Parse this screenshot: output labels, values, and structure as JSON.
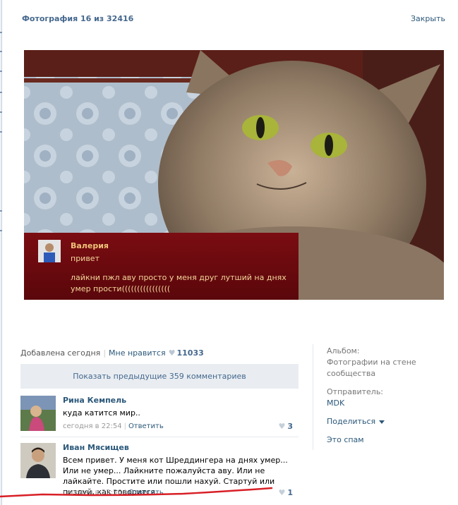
{
  "header": {
    "title": "Фотография 16 из 32416",
    "close_label": "Закрыть"
  },
  "photo_comment": {
    "author": "Валерия",
    "line1": "привет",
    "line2": "лайкни пжл аву просто у меня друг лутший на днях умер прости(((((((((((((((("
  },
  "info": {
    "added": "Добавлена сегодня",
    "like_label": "Мне нравится",
    "like_count": "11033"
  },
  "sidebar": {
    "album_label": "Альбом:",
    "album_value": "Фотографии на стене сообщества",
    "sender_label": "Отправитель:",
    "sender_value": "MDK",
    "share_label": "Поделиться",
    "spam_label": "Это спам"
  },
  "comments": {
    "show_prev": "Показать предыдущие 359 комментариев",
    "items": [
      {
        "author": "Рина Кемпель",
        "text": "куда катится мир..",
        "time": "сегодня в 22:54",
        "reply": "Ответить",
        "likes": "3"
      },
      {
        "author": "Иван Мясищев",
        "text": "Всем привет. У меня кот Шреддингера на днях умер... Или не умер... Лайкните пожалуйста аву. Или не лайкайте. Простите или пошли нахуй. Стартуй или пиздуй, как говорится...",
        "time": "сегодня в 22:56",
        "reply": "Ответить",
        "likes": "1"
      }
    ]
  },
  "colors": {
    "link": "#2b587a",
    "title": "#45688e",
    "overlay": "#6b0a0f",
    "overlay_text": "#f5d59a",
    "annotation_red": "#d81f26"
  },
  "icons": [
    "heart-icon",
    "chevron-down-icon"
  ]
}
